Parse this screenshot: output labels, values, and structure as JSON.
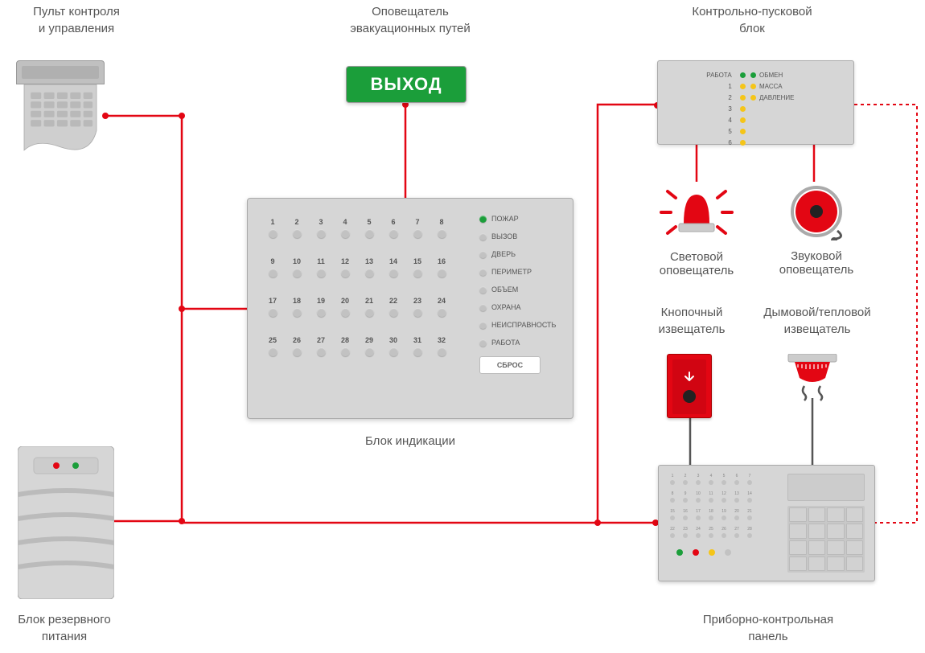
{
  "labels": {
    "keypad": "Пульт контроля\nи управления",
    "exit": "Оповещатель\nэвакуационных путей",
    "clblock": "Контрольно-пусковой\nблок",
    "siren": "Световой\nоповещатель",
    "bell": "Звуковой\nоповещатель",
    "mcp": "Кнопочный\nизвещатель",
    "smoke": "Дымовой/тепловой\nизвещатель",
    "indblock": "Блок индикации",
    "power": "Блок резервного\nпитания",
    "cpanel": "Приборно-контрольная\nпанель"
  },
  "exit_text": "ВЫХОД",
  "clblock": {
    "left_header": "РАБОТА",
    "nums": [
      "1",
      "2",
      "3",
      "4",
      "5",
      "6"
    ],
    "right": [
      "ОБМЕН",
      "МАССА",
      "ДАВЛЕНИЕ"
    ]
  },
  "indblock": {
    "rows": 4,
    "cols": 8,
    "status": [
      {
        "label": "ПОЖАР",
        "active": true
      },
      {
        "label": "ВЫЗОВ",
        "active": false
      },
      {
        "label": "ДВЕРЬ",
        "active": false
      },
      {
        "label": "ПЕРИМЕТР",
        "active": false
      },
      {
        "label": "ОБЪЕМ",
        "active": false
      },
      {
        "label": "ОХРАНА",
        "active": false
      },
      {
        "label": "НЕИСПРАВНОСТЬ",
        "active": false
      },
      {
        "label": "РАБОТА",
        "active": false
      }
    ],
    "reset": "СБРОС"
  },
  "cpanel": {
    "rows": 4,
    "cols": 7
  },
  "colors": {
    "red": "#e30613",
    "green": "#1b9e3a",
    "yellow": "#f5c518",
    "panel": "#d6d6d6"
  }
}
